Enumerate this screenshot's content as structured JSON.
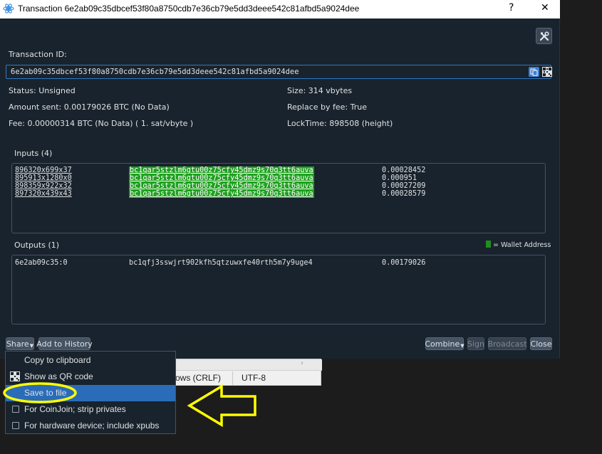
{
  "window": {
    "title": "Transaction 6e2ab09c35dbcef53f80a8750cdb7e36cb79e5dd3deee542c81afbd5a9024dee",
    "help_label": "?",
    "close_label": "✕"
  },
  "tx": {
    "id_label": "Transaction ID:",
    "id_value": "6e2ab09c35dbcef53f80a8750cdb7e36cb79e5dd3deee542c81afbd5a9024dee",
    "status": "Status: Unsigned",
    "amount_sent": "Amount sent: 0.00179026 BTC (No Data)",
    "fee": "Fee: 0.00000314 BTC (No Data)  ( 1. sat/vbyte )",
    "size": "Size: 314 vbytes",
    "rbf": "Replace by fee: True",
    "locktime": "LockTime: 898508 (height)"
  },
  "inputs": {
    "label": "Inputs (4)",
    "rows": [
      {
        "outpoint": "896320x699x37",
        "address": "bc1qar5stzlm6gtu00z75cfy45dmz9s70q3tt6auva",
        "amount": "0.00028452"
      },
      {
        "outpoint": "895913x1280x0",
        "address": "bc1qar5stzlm6gtu00z75cfy45dmz9s70q3tt6auva",
        "amount": "0.000951"
      },
      {
        "outpoint": "898359x922x32",
        "address": "bc1qar5stzlm6gtu00z75cfy45dmz9s70q3tt6auva",
        "amount": "0.00027209"
      },
      {
        "outpoint": "897320x439x43",
        "address": "bc1qar5stzlm6gtu00z75cfy45dmz9s70q3tt6auva",
        "amount": "0.00028579"
      }
    ]
  },
  "outputs": {
    "label": "Outputs (1)",
    "legend": "= Wallet Address",
    "rows": [
      {
        "outpoint": "6e2ab09c35:0",
        "address": "bc1qfj3sswjrt902kfh5qtzuwxfe40rth5m7y9uge4",
        "amount": "0.00179026"
      }
    ]
  },
  "buttons": {
    "share": "Share",
    "add_history": "Add to History",
    "combine": "Combine",
    "sign": "Sign",
    "broadcast": "Broadcast",
    "close": "Close"
  },
  "share_menu": {
    "items": [
      {
        "label": "Copy to clipboard"
      },
      {
        "label": "Show as QR code"
      },
      {
        "label": "Save to file"
      },
      {
        "label": "For CoinJoin; strip privates"
      },
      {
        "label": "For hardware device; include xpubs"
      }
    ]
  },
  "background_editor": {
    "line_ending": "ows (CRLF)",
    "encoding": "UTF-8"
  },
  "colors": {
    "window_bg": "#19232d",
    "wallet_highlight": "#1fa01f",
    "menu_selected": "#2b6cb8",
    "annotation": "#ffff00"
  }
}
